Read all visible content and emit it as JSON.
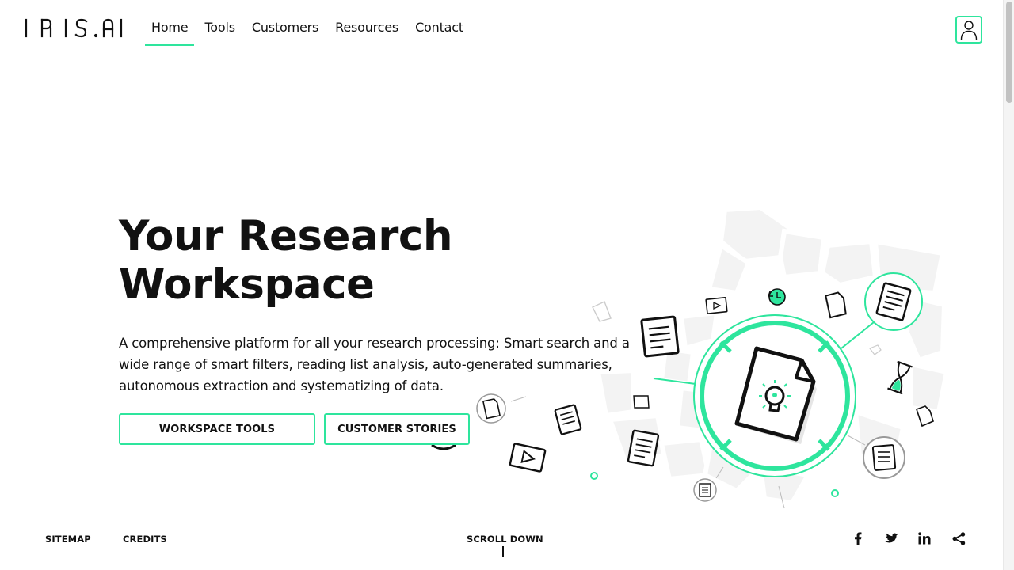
{
  "brand": {
    "name": "IRIS.AI",
    "accent_color": "#2ee59d"
  },
  "nav": {
    "items": [
      {
        "label": "Home",
        "active": true
      },
      {
        "label": "Tools",
        "active": false
      },
      {
        "label": "Customers",
        "active": false
      },
      {
        "label": "Resources",
        "active": false
      },
      {
        "label": "Contact",
        "active": false
      }
    ],
    "account_icon": "user-icon"
  },
  "hero": {
    "title_line1": "Your Research",
    "title_line2": "Workspace",
    "description": "A comprehensive platform for all your research processing: Smart search and a wide range of smart filters, reading list analysis, auto-generated summaries, autonomous extraction and systematizing of data.",
    "buttons": {
      "tools_label": "WORKSPACE TOOLS",
      "stories_label": "CUSTOMER STORIES"
    },
    "illustration_icons": [
      "document-lightbulb-icon",
      "document-icon",
      "video-icon",
      "clock-icon",
      "hourglass-icon"
    ]
  },
  "footer": {
    "sitemap_label": "SITEMAP",
    "credits_label": "CREDITS",
    "scroll_label": "SCROLL DOWN",
    "social_icons": [
      "facebook-icon",
      "twitter-icon",
      "linkedin-icon",
      "share-icon"
    ]
  }
}
